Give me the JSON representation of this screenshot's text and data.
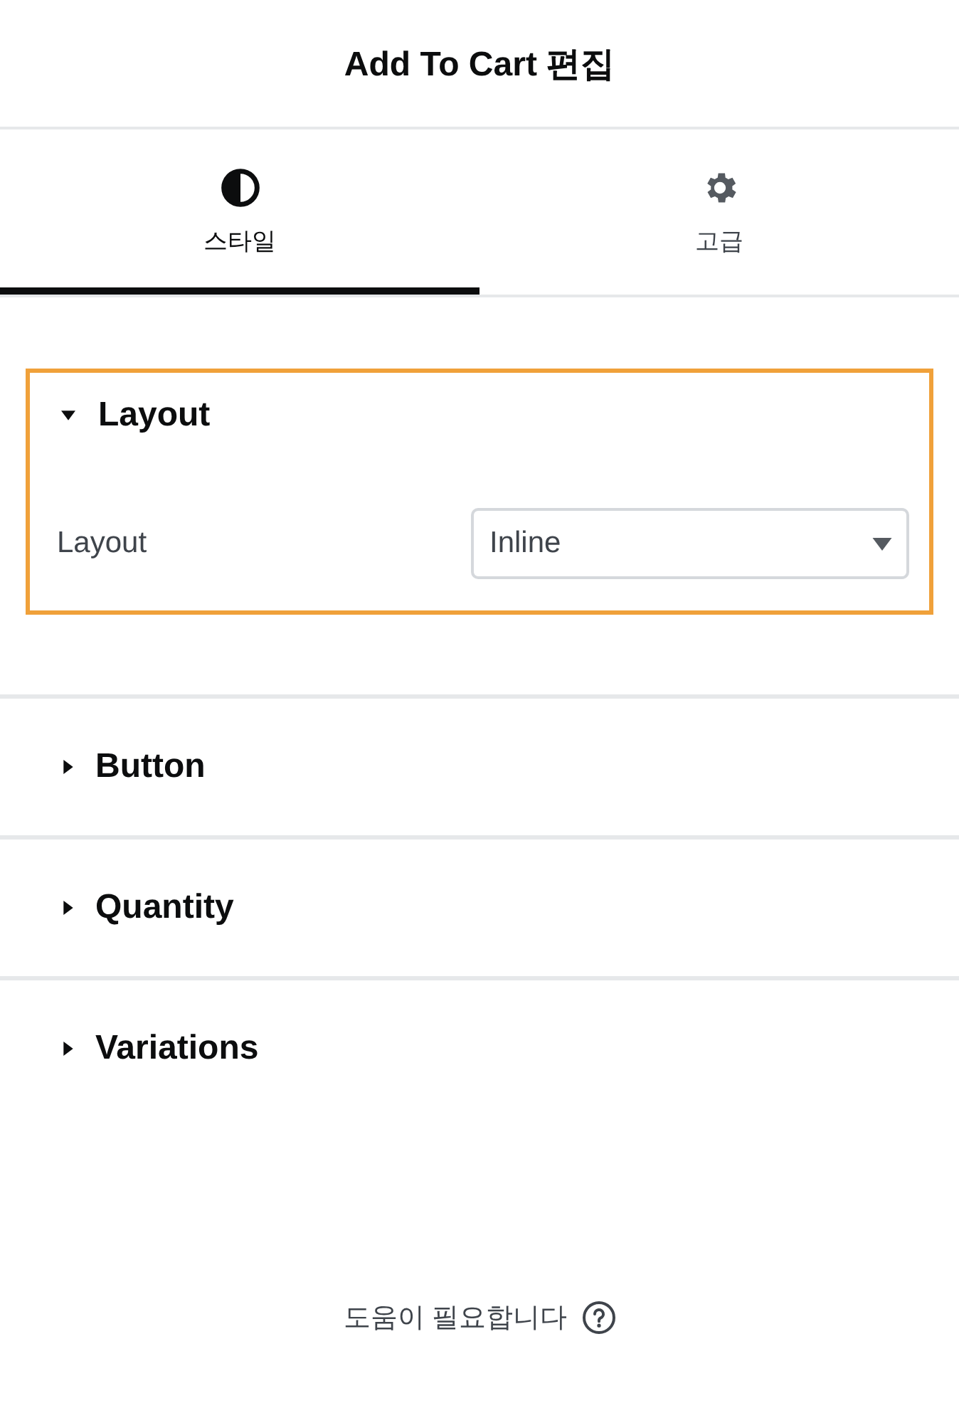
{
  "header": {
    "title": "Add To Cart 편집"
  },
  "tabs": [
    {
      "label": "스타일",
      "selected": true
    },
    {
      "label": "고급",
      "selected": false
    }
  ],
  "sections": [
    {
      "title": "Layout",
      "expanded": true,
      "highlighted": true,
      "controls": [
        {
          "label": "Layout",
          "value": "Inline"
        }
      ]
    },
    {
      "title": "Button",
      "expanded": false,
      "highlighted": false
    },
    {
      "title": "Quantity",
      "expanded": false,
      "highlighted": false
    },
    {
      "title": "Variations",
      "expanded": false,
      "highlighted": false
    }
  ],
  "help": {
    "text": "도움이 필요합니다"
  }
}
